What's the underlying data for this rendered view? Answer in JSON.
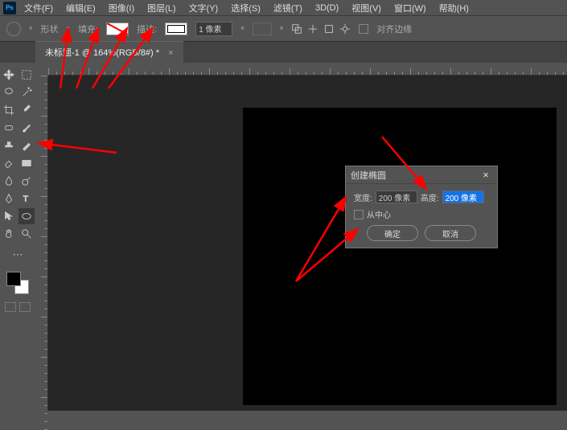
{
  "menu": {
    "items": [
      "文件(F)",
      "编辑(E)",
      "图像(I)",
      "图层(L)",
      "文字(Y)",
      "选择(S)",
      "滤镜(T)",
      "3D(D)",
      "视图(V)",
      "窗口(W)",
      "帮助(H)"
    ]
  },
  "options": {
    "shape_label": "形状",
    "fill_label": "填充:",
    "stroke_label": "描边:",
    "stroke_width": "1 像素",
    "align_edges": "对齐边缘"
  },
  "document": {
    "tab_title": "未标题-1 @ 164%(RGB/8#) *",
    "close": "×"
  },
  "dialog": {
    "title": "创建椭圆",
    "width_label": "宽度:",
    "width_value": "200 像素",
    "height_label": "高度:",
    "height_value": "200 像素",
    "from_center": "从中心",
    "ok": "确定",
    "cancel": "取消",
    "close": "×"
  },
  "icons": {
    "ps": "Ps"
  }
}
